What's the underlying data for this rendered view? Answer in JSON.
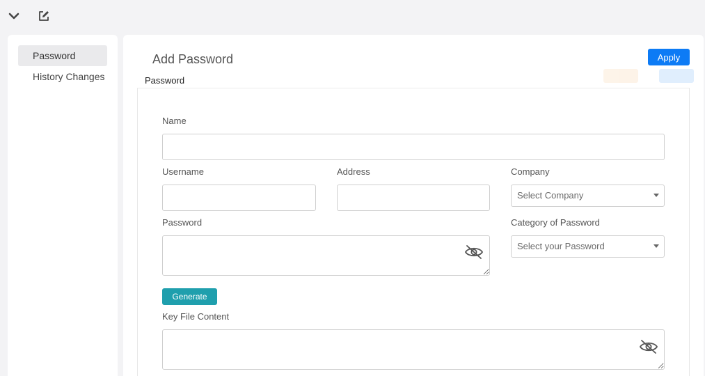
{
  "toolbar": {
    "collapse_icon": "chevron-down-icon",
    "edit_icon": "edit-icon"
  },
  "sidebar": {
    "items": [
      {
        "label": "Password",
        "active": true
      },
      {
        "label": "History Changes",
        "active": false
      }
    ]
  },
  "main": {
    "title": "Add Password",
    "apply_label": "Apply",
    "section_label": "Password",
    "form": {
      "name_label": "Name",
      "name_value": "",
      "username_label": "Username",
      "username_value": "",
      "address_label": "Address",
      "address_value": "",
      "company_label": "Company",
      "company_placeholder": "Select Company",
      "password_label": "Password",
      "password_value": "",
      "category_label": "Category of Password",
      "category_placeholder": "Select your Password",
      "generate_label": "Generate",
      "keyfile_label": "Key File Content",
      "keyfile_value": ""
    }
  },
  "colors": {
    "accent": "#0d7bf5",
    "generate": "#1f9fad",
    "background": "#f3f3f5"
  }
}
